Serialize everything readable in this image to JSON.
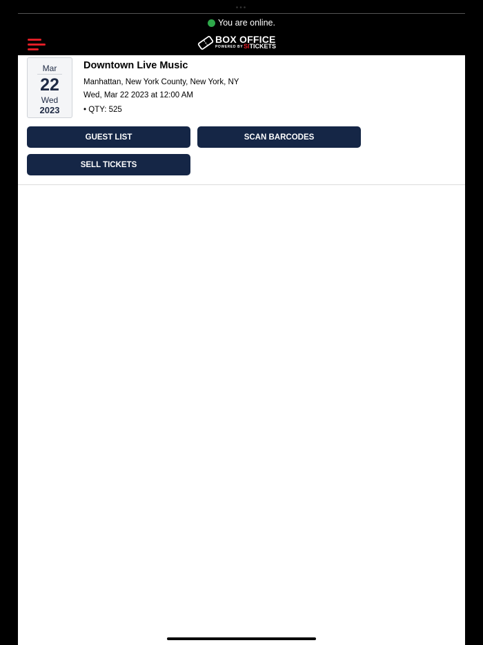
{
  "status": {
    "text": "You are online.",
    "color": "#2ea84a"
  },
  "header": {
    "menu_icon": "hamburger-menu-icon",
    "logo": {
      "line1": "BOX OFFICE",
      "line2": "POWERED BY",
      "brand_si": "SI",
      "brand_tickets": "TICKETS"
    }
  },
  "event": {
    "month": "Mar",
    "day": "22",
    "weekday": "Wed",
    "year": "2023",
    "title": "Downtown Live Music",
    "location": "Manhattan, New York County, New York, NY",
    "datetime": "Wed, Mar 22 2023 at 12:00 AM",
    "qty": "• QTY: 525"
  },
  "actions": {
    "guest_list": "GUEST LIST",
    "scan_barcodes": "SCAN BARCODES",
    "sell_tickets": "SELL TICKETS"
  },
  "colors": {
    "button_bg": "#152646",
    "accent_red": "#e01e26"
  }
}
